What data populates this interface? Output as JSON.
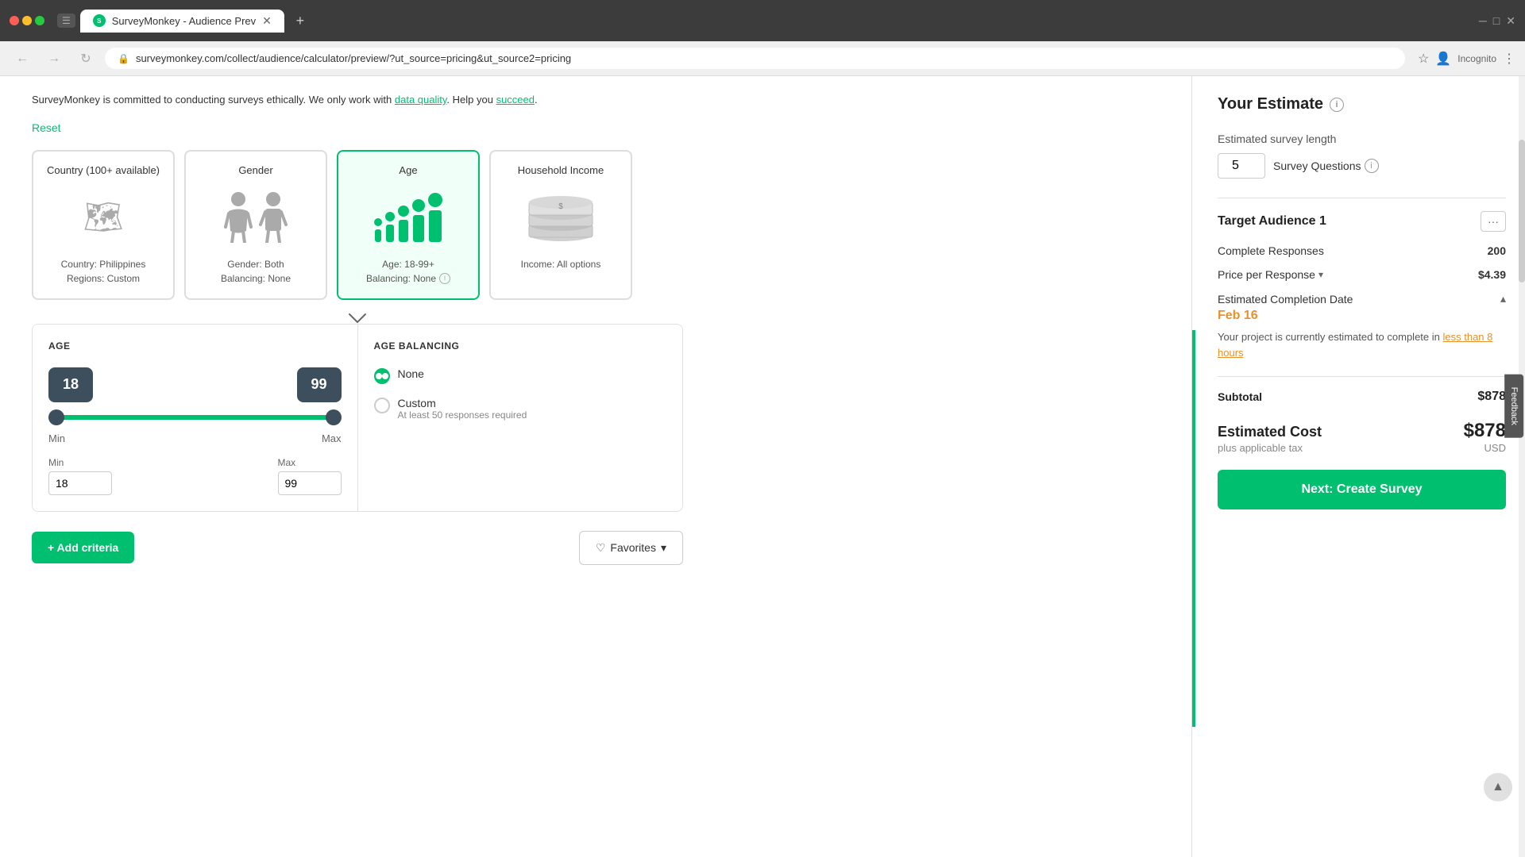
{
  "browser": {
    "tab_label": "SurveyMonkey - Audience Prev",
    "address": "surveymonkey.com/collect/audience/calculator/preview/?ut_source=pricing&ut_source2=pricing",
    "incognito_label": "Incognito"
  },
  "page": {
    "reset_label": "Reset",
    "intro_text_parts": [
      "SurveyMonkey is committed to conducting surveys ethically. We only work with",
      "data quality"
    ]
  },
  "criteria_cards": [
    {
      "id": "country",
      "title": "Country (100+ available)",
      "info_line1": "Country: Philippines",
      "info_line2": "Regions: Custom",
      "active": false
    },
    {
      "id": "gender",
      "title": "Gender",
      "info_line1": "Gender: Both",
      "info_line2": "Balancing: None",
      "active": false
    },
    {
      "id": "age",
      "title": "Age",
      "info_line1": "Age: 18-99+",
      "info_line2": "Balancing: None",
      "active": true
    },
    {
      "id": "household_income",
      "title": "Household Income",
      "info_line1": "Income: All options",
      "info_line2": "",
      "active": false
    }
  ],
  "age_panel": {
    "title": "AGE",
    "min_label": "Min",
    "max_label": "Max",
    "min_value": "18",
    "max_value": "99",
    "slider_min": "18",
    "slider_max": "99"
  },
  "balancing_panel": {
    "title": "AGE BALANCING",
    "options": [
      {
        "id": "none",
        "label": "None",
        "selected": true,
        "sublabel": ""
      },
      {
        "id": "custom",
        "label": "Custom",
        "selected": false,
        "sublabel": "At least 50 responses required"
      }
    ]
  },
  "bottom_bar": {
    "add_criteria_label": "+ Add criteria",
    "favorites_label": "Favorites"
  },
  "sidebar": {
    "estimate_title": "Your Estimate",
    "survey_length_label": "Estimated survey length",
    "survey_questions_value": "5",
    "survey_questions_label": "Survey Questions",
    "target_audience_label": "Target Audience 1",
    "complete_responses_label": "Complete Responses",
    "complete_responses_value": "200",
    "price_per_response_label": "Price per Response",
    "price_per_response_value": "$4.39",
    "completion_date_label": "Estimated Completion Date",
    "completion_date_value": "Feb 16",
    "completion_desc_pre": "Your project is currently estimated to complete in",
    "completion_link": "less than 8 hours",
    "subtotal_label": "Subtotal",
    "subtotal_value": "$878",
    "estimated_cost_label": "Estimated Cost",
    "estimated_cost_value": "$878",
    "tax_label": "plus applicable tax",
    "currency_label": "USD",
    "next_button_label": "Next: Create Survey"
  }
}
